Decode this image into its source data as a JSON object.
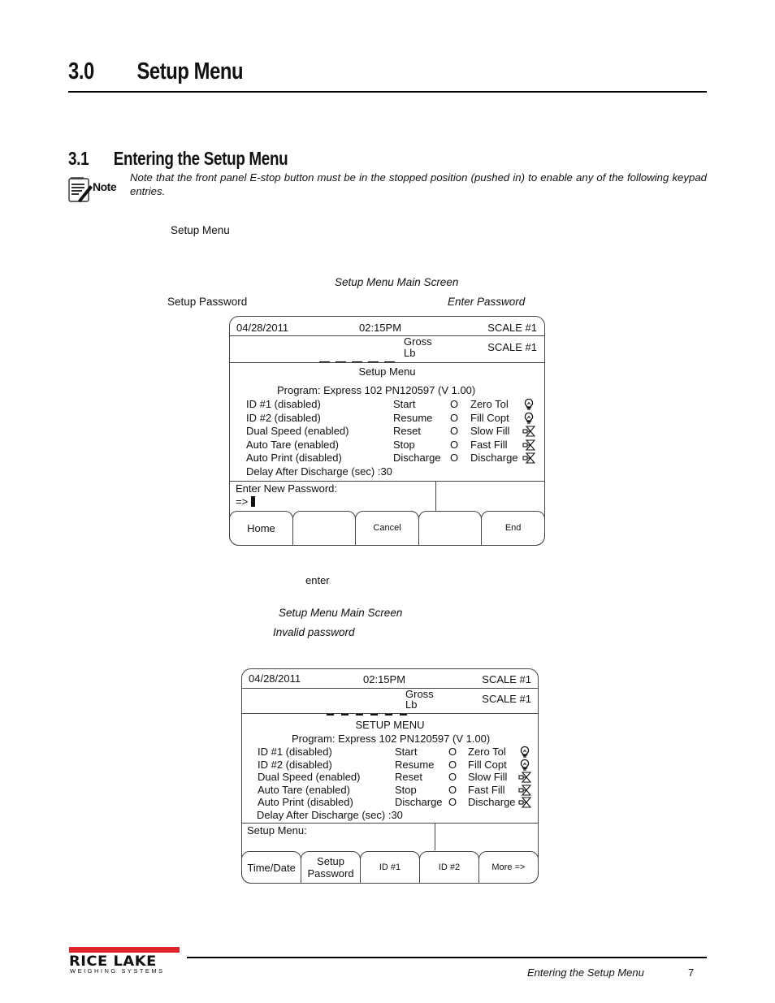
{
  "page": {
    "heading1": {
      "number": "3.0",
      "title": "Setup Menu"
    },
    "heading2": {
      "number": "3.1",
      "title": "Entering the Setup Menu"
    },
    "note": {
      "label": "Note",
      "text": "Note that the front panel E-stop button must be in the stopped position (pushed in) to enable any of the following keypad entries."
    },
    "body_fragments": {
      "setup_menu": "Setup  Menu",
      "setup_menu_main_screen_1": "Setup Menu Main Screen",
      "setup_password": "Setup Password",
      "enter_password": "Enter Password",
      "enter": "enter",
      "setup_menu_main_screen_2": "Setup Menu Main Screen",
      "invalid_password": "Invalid password"
    }
  },
  "screen1": {
    "date": "04/28/2011",
    "time": "02:15PM",
    "scale_top": "SCALE #1",
    "mode": "Gross",
    "unit": "Lb",
    "scale_weight": "SCALE #1",
    "menu_title": "Setup Menu",
    "program": "Program: Express 102 PN120597  (V 1.00)",
    "settings": [
      "ID #1 (disabled)",
      "ID #2 (disabled)",
      "Dual Speed (enabled)",
      "Auto Tare (enabled)",
      "Auto Print (disabled)"
    ],
    "inputs": [
      "Start",
      "Resume",
      "Reset",
      "Stop",
      "Discharge"
    ],
    "input_states": [
      "O",
      "O",
      "O",
      "O",
      "O"
    ],
    "outputs": [
      "Zero Tol",
      "Fill Copt",
      "Slow Fill",
      "Fast Fill",
      "Discharge"
    ],
    "output_icons": [
      "bulb-icon",
      "bulb-icon",
      "valve-icon",
      "valve-icon",
      "valve-icon"
    ],
    "delay": "Delay After Discharge (sec) :30",
    "prompt": "Enter New Password:",
    "entry": "=>",
    "softkeys": [
      "Home",
      "",
      "Cancel",
      "",
      "End"
    ]
  },
  "screen2": {
    "date": "04/28/2011",
    "time": "02:15PM",
    "scale_top": "SCALE #1",
    "mode": "Gross",
    "unit": "Lb",
    "scale_weight": "SCALE #1",
    "menu_title": "SETUP MENU",
    "program": "Program: Express 102 PN120597 (V 1.00)",
    "settings": [
      "ID #1 (disabled)",
      "ID #2 (disabled)",
      "Dual Speed (enabled)",
      "Auto Tare (enabled)",
      "Auto Print (disabled)"
    ],
    "inputs": [
      "Start",
      "Resume",
      "Reset",
      "Stop",
      "Discharge"
    ],
    "input_states": [
      "O",
      "O",
      "O",
      "O",
      "O"
    ],
    "outputs": [
      "Zero Tol",
      "Fill Copt",
      "Slow Fill",
      "Fast Fill",
      "Discharge"
    ],
    "output_icons": [
      "bulb-icon",
      "bulb-icon",
      "valve-icon",
      "valve-icon",
      "valve-icon"
    ],
    "delay": "Delay After Discharge (sec) :30",
    "prompt": "Setup Menu:",
    "softkeys": [
      "Time/Date",
      "Setup Password",
      "ID #1",
      "ID #2",
      "More =>"
    ]
  },
  "footer": {
    "brand": "RICE LAKE",
    "brand_sub": "WEIGHING SYSTEMS",
    "brand_color": "#e0242b",
    "section_title": "Entering the Setup Menu",
    "page_number": "7"
  }
}
